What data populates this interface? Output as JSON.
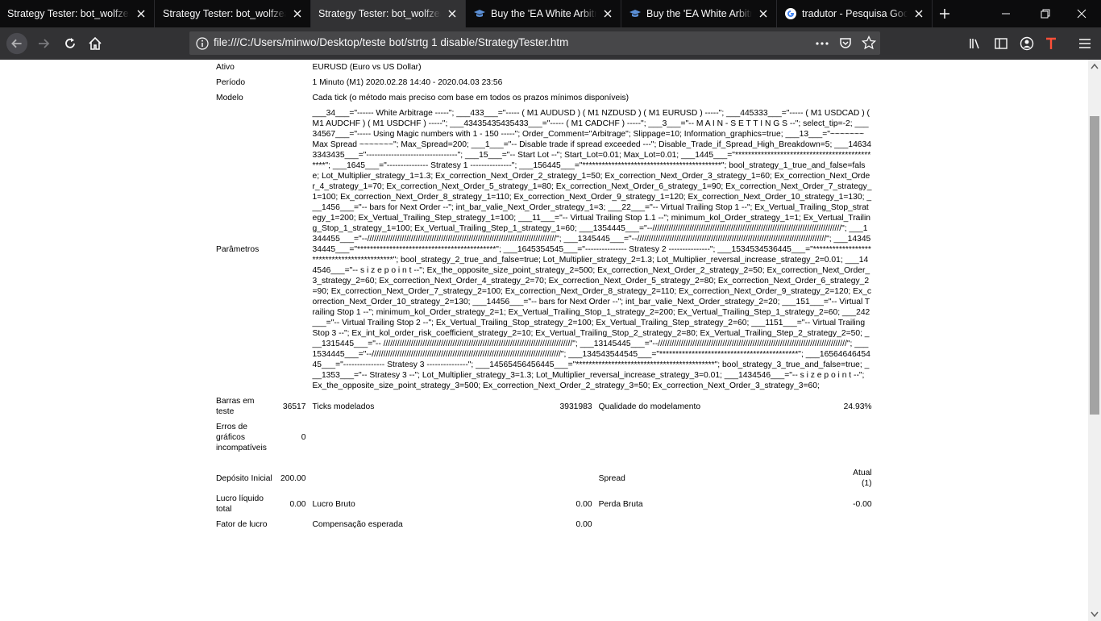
{
  "browser": {
    "tabs": [
      {
        "title": "Strategy Tester: bot_wolfzeach",
        "favicon": "none",
        "active": false
      },
      {
        "title": "Strategy Tester: bot_wolfzeach",
        "favicon": "none",
        "active": false
      },
      {
        "title": "Strategy Tester: bot_wolfzeach",
        "favicon": "none",
        "active": true
      },
      {
        "title": "Buy the 'EA White Arbitrage'",
        "favicon": "mortarboard-icon",
        "active": false
      },
      {
        "title": "Buy the 'EA White Arbitrage'",
        "favicon": "mortarboard-icon",
        "active": false
      },
      {
        "title": "tradutor - Pesquisa Google",
        "favicon": "google-icon",
        "active": false
      }
    ],
    "url": "file:///C:/Users/minwo/Desktop/teste bot/strtg 1 disable/StrategyTester.htm",
    "colors": {
      "chrome": "#0c0c0d",
      "toolbar": "#323234",
      "urlbar": "#474749",
      "accent": "#ff4f38"
    }
  },
  "report": {
    "ativo_label": "Ativo",
    "ativo_value": "EURUSD (Euro vs US Dollar)",
    "periodo_label": "Período",
    "periodo_value": "1 Minuto (M1) 2020.02.28 14:40 - 2020.04.03 23:56",
    "modelo_label": "Modelo",
    "modelo_value": "Cada tick (o método mais preciso com base em todos os prazos mínimos disponíveis)",
    "parametros_label": "Parâmetros",
    "parametros_value": "___34___=\"------ White Arbitrage -----\"; ___433___=\"----- ( M1 AUDUSD ) ( M1 NZDUSD ) ( M1 EURUSD ) -----\"; ___445333___=\"----- ( M1 USDCAD ) ( M1 AUDCHF ) ( M1 USDCHF ) -----\"; ___43435435435433___=\"----- ( M1 CADCHF ) -----\"; ___3___=\"-- M A I N - S E T T I N G S --\"; select_tip=-2; ___34567___=\"----- Using Magic numbers with 1 - 150 -----\"; Order_Comment=\"Arbitrage\"; Slippage=10; Information_graphics=true; ___13___=\"~~~~~~~ Max Spread ~~~~~~~\"; Max_Spread=200; ___1___=\"-- Disable trade if spread exceeded ---\"; Disable_Trade_if_Spread_High_Breakdown=5; ___146343343435___=\"---------------------------------\"; ___15___=\"-- Start Lot --\"; Start_Lot=0.01; Max_Lot=0.01; ___1445___=\"**********************************************\"; ___1645___=\"--------------- Stratesy 1 ---------------\"; ___156445___=\"*******************************************\"; bool_strategy_1_true_and_false=false; Lot_Multiplier_strategy_1=1.3; Ex_correction_Next_Order_2_strategy_1=50; Ex_correction_Next_Order_3_strategy_1=60; Ex_correction_Next_Order_4_strategy_1=70; Ex_correction_Next_Order_5_strategy_1=80; Ex_correction_Next_Order_6_strategy_1=90; Ex_correction_Next_Order_7_strategy_1=100; Ex_correction_Next_Order_8_strategy_1=110; Ex_correction_Next_Order_9_strategy_1=120; Ex_correction_Next_Order_10_strategy_1=130; ___1456___=\"-- bars for Next Order --\"; int_bar_valie_Next_Order_strategy_1=3; ___22___=\"-- Virtual Trailing Stop 1 --\"; Ex_Vertual_Trailing_Stop_strategy_1=200; Ex_Vertual_Trailing_Step_strategy_1=100; ___11___=\"-- Virtual Trailing Stop 1.1 --\"; minimum_kol_Order_strategy_1=1; Ex_Vertual_Trailing_Stop_1_strategy_1=100; Ex_Vertual_Trailing_Step_1_strategy_1=60; ___1354445___=\"--//////////////////////////////////////////////////////////////////////////////////\"; ___1344455___=\"--//////////////////////////////////////////////////////////////////////////////////\"; ___1345445___=\"--//////////////////////////////////////////////////////////////////////////////////\"; ___1434534445___=\"*******************************************\"; ___1645354545___=\"--------------- Stratesy 2 ---------------\"; ___1534534536445___=\"*******************************************\"; bool_strategy_2_true_and_false=true; Lot_Multiplier_strategy_2=1.3; Lot_Multiplier_reversal_increase_strategy_2=0.01; ___144546___=\"-- s i z e p o i n t --\"; Ex_the_opposite_size_point_strategy_2=500; Ex_correction_Next_Order_2_strategy_2=50; Ex_correction_Next_Order_3_strategy_2=60; Ex_correction_Next_Order_4_strategy_2=70; Ex_correction_Next_Order_5_strategy_2=80; Ex_correction_Next_Order_6_strategy_2=90; Ex_correction_Next_Order_7_strategy_2=100; Ex_correction_Next_Order_8_strategy_2=110; Ex_correction_Next_Order_9_strategy_2=120; Ex_correction_Next_Order_10_strategy_2=130; ___14456___=\"-- bars for Next Order --\"; int_bar_valie_Next_Order_strategy_2=20; ___151___=\"-- Virtual Trailing Stop 1 --\"; minimum_kol_Order_strategy_2=1; Ex_Vertual_Trailing_Stop_1_strategy_2=200; Ex_Vertual_Trailing_Step_1_strategy_2=60; ___242___=\"-- Virtual Trailing Stop 2 --\"; Ex_Vertual_Trailing_Stop_strategy_2=100; Ex_Vertual_Trailing_Step_strategy_2=60; ___1151___=\"-- Virtual Trailing Stop 3 --\"; Ex_int_kol_order_risk_coefficient_strategy_2=10; Ex_Vertual_Trailing_Stop_2_strategy_2=80; Ex_Vertual_Trailing_Step_2_strategy_2=50; ___1315445___=\"-- //////////////////////////////////////////////////////////////////////////////////\"; ___13145445___=\"--//////////////////////////////////////////////////////////////////////////////////\"; ___1534445___=\"--//////////////////////////////////////////////////////////////////////////////////\"; ___134543544545___=\"*******************************************\"; ___1656464645445___=\"--------------- Stratesy 3 ---------------\"; ___14565456456445___=\"*******************************************\"; bool_strategy_3_true_and_false=true; ___1353___=\"-- Stratesy 3 --\"; Lot_Multiplier_strategy_3=1.3; Lot_Multiplier_reversal_increase_strategy_3=0.01; ___1434546___=\"-- s i z e p o i n t --\"; Ex_the_opposite_size_point_strategy_3=500; Ex_correction_Next_Order_2_strategy_3=50; Ex_correction_Next_Order_3_strategy_3=60;",
    "barras_label": "Barras em teste",
    "barras_value": "36517",
    "ticks_label": "Ticks modelados",
    "ticks_value": "3931983",
    "qualidade_label": "Qualidade do modelamento",
    "qualidade_value": "24.93%",
    "erros_label": "Erros de gráficos incompatíveis",
    "erros_value": "0",
    "deposito_label": "Depósito Inicial",
    "deposito_value": "200.00",
    "spread_label": "Spread",
    "spread_value": "Atual (1)",
    "lucro_liquido_label": "Lucro líquido total",
    "lucro_liquido_value": "0.00",
    "lucro_bruto_label": "Lucro Bruto",
    "lucro_bruto_value": "0.00",
    "perda_bruta_label": "Perda Bruta",
    "perda_bruta_value": "-0.00",
    "fator_label": "Fator de lucro",
    "fator_value": "",
    "compensacao_label": "Compensação esperada",
    "compensacao_value": "0.00"
  }
}
